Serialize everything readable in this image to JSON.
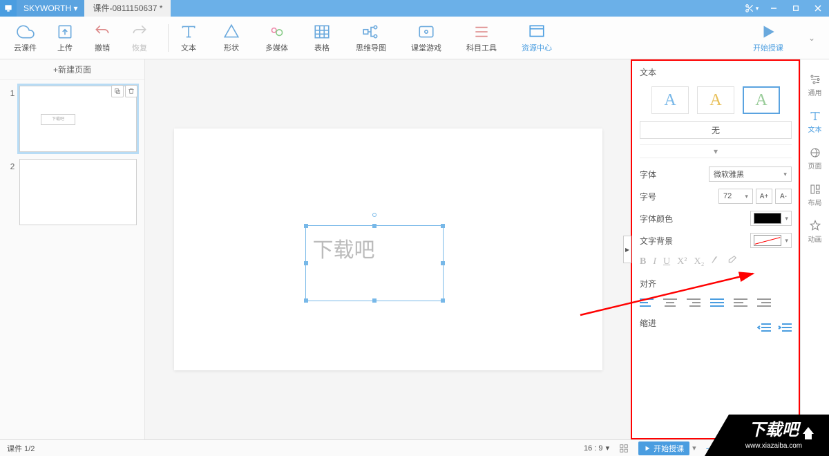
{
  "titlebar": {
    "brand": "SKYWORTH ▾",
    "tab": "课件-0811150637 *"
  },
  "toolbar": {
    "cloud": "云课件",
    "upload": "上传",
    "undo": "撤销",
    "redo": "恢复",
    "text": "文本",
    "shape": "形状",
    "media": "多媒体",
    "table": "表格",
    "mind": "思维导图",
    "game": "课堂游戏",
    "subject": "科目工具",
    "resource": "资源中心",
    "start": "开始授课"
  },
  "sidebar": {
    "newpage": "+新建页面",
    "slide1_text": "下载吧"
  },
  "canvas": {
    "text": "下载吧"
  },
  "panel": {
    "title": "文本",
    "none": "无",
    "font_label": "字体",
    "font_value": "微软雅黑",
    "size_label": "字号",
    "size_value": "72",
    "a_plus": "A+",
    "a_minus": "A-",
    "color_label": "字体颜色",
    "bg_label": "文字背景",
    "align_label": "对齐",
    "indent_label": "缩进",
    "b": "B",
    "i": "I",
    "u": "U",
    "x2": "X²",
    "x2b": "X₂"
  },
  "sidetabs": {
    "general": "通用",
    "text": "文本",
    "page": "页面",
    "layout": "布局",
    "anim": "动画"
  },
  "status": {
    "page": "课件 1/2",
    "ratio": "16 : 9",
    "play": "开始授课"
  },
  "watermark": {
    "brand": "下载吧",
    "url": "www.xiazaiba.com"
  }
}
